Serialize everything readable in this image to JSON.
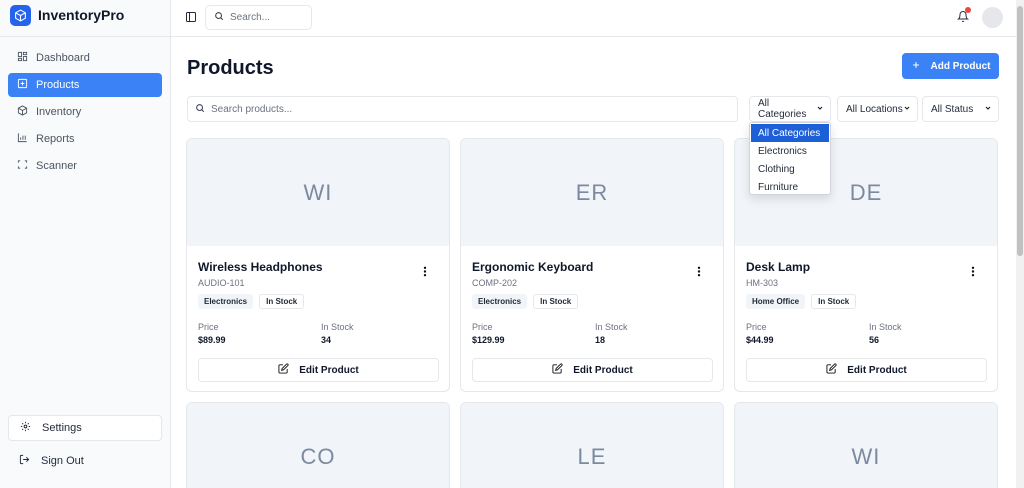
{
  "app": {
    "name": "InventoryPro"
  },
  "sidebar": {
    "items": [
      {
        "label": "Dashboard",
        "icon": "grid-icon"
      },
      {
        "label": "Products",
        "icon": "box-plus-icon",
        "active": true
      },
      {
        "label": "Inventory",
        "icon": "package-icon"
      },
      {
        "label": "Reports",
        "icon": "bar-chart-icon"
      },
      {
        "label": "Scanner",
        "icon": "scan-icon"
      }
    ],
    "settings_label": "Settings",
    "signout_label": "Sign Out"
  },
  "header": {
    "search_placeholder": "Search..."
  },
  "main": {
    "title": "Products",
    "add_label": "Add Product",
    "search_placeholder": "Search products...",
    "filters": {
      "category": "All Categories",
      "location": "All Locations",
      "status": "All Status"
    },
    "category_options": [
      "All Categories",
      "Electronics",
      "Clothing",
      "Furniture"
    ],
    "price_label": "Price",
    "stock_label": "In Stock",
    "edit_label": "Edit Product",
    "products": [
      {
        "initials": "WI",
        "name": "Wireless Headphones",
        "sku": "AUDIO-101",
        "category": "Electronics",
        "status": "In Stock",
        "price": "$89.99",
        "stock": "34"
      },
      {
        "initials": "ER",
        "name": "Ergonomic Keyboard",
        "sku": "COMP-202",
        "category": "Electronics",
        "status": "In Stock",
        "price": "$129.99",
        "stock": "18"
      },
      {
        "initials": "DE",
        "name": "Desk Lamp",
        "sku": "HM-303",
        "category": "Home Office",
        "status": "In Stock",
        "price": "$44.99",
        "stock": "56"
      },
      {
        "initials": "CO"
      },
      {
        "initials": "LE"
      },
      {
        "initials": "WI"
      }
    ]
  },
  "colors": {
    "accent": "#3b82f6",
    "notification": "#ef4444",
    "dropdown_selected": "#1d5fd6"
  }
}
